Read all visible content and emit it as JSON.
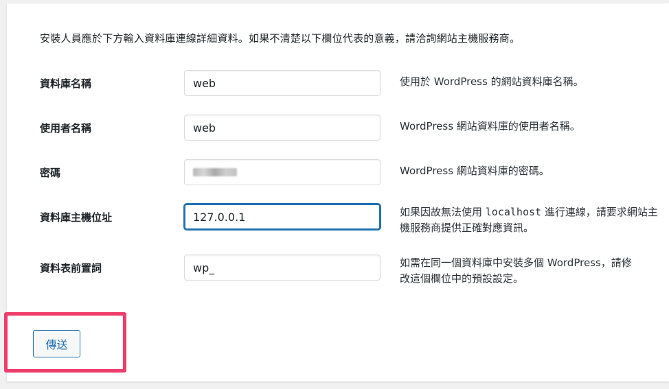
{
  "intro_text": "安裝人員應於下方輸入資料庫連線詳細資料。如果不清楚以下欄位代表的意義，請洽詢網站主機服務商。",
  "fields": {
    "dbname": {
      "label": "資料庫名稱",
      "value": "web",
      "description": "使用於 WordPress 的網站資料庫名稱。"
    },
    "uname": {
      "label": "使用者名稱",
      "value": "web",
      "description": "WordPress 網站資料庫的使用者名稱。"
    },
    "pwd": {
      "label": "密碼",
      "value": "",
      "description": "WordPress 網站資料庫的密碼。"
    },
    "dbhost": {
      "label": "資料庫主機位址",
      "value": "127.0.0.1",
      "description_before": "如果因故無法使用 ",
      "description_code": "localhost",
      "description_after": " 進行連線，請要求網站主機服務商提供正確對應資訊。"
    },
    "prefix": {
      "label": "資料表前置詞",
      "value": "wp_",
      "description": "如需在同一個資料庫中安裝多個 WordPress，請修改這個欄位中的預設設定。"
    }
  },
  "submit_label": "傳送",
  "colors": {
    "accent": "#2271b1",
    "highlight": "#ee3d6a",
    "background": "#f1f1f1"
  }
}
